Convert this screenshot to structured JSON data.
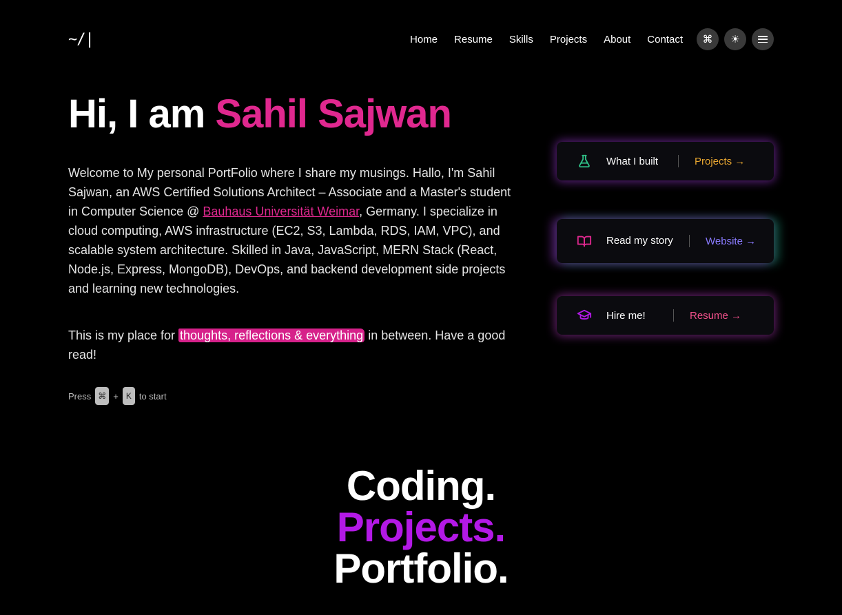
{
  "header": {
    "logo": "~/|",
    "nav": [
      "Home",
      "Resume",
      "Skills",
      "Projects",
      "About",
      "Contact"
    ],
    "icons": [
      "command-icon",
      "sun-icon",
      "menu-icon"
    ],
    "command_glyph": "⌘",
    "sun_glyph": "☀"
  },
  "hero": {
    "greeting": "Hi, I am ",
    "name": "Sahil Sajwan"
  },
  "intro": {
    "text_before_link": "Welcome to My personal PortFolio where I share my musings. Hallo, I'm Sahil Sajwan, an AWS Certified Solutions Architect – Associate and a Master's student in Computer Science @ ",
    "link_text": "Bauhaus Universität Weimar",
    "text_after_link": ", Germany. I specialize in cloud computing, AWS infrastructure (EC2, S3, Lambda, RDS, IAM, VPC), and scalable system architecture. Skilled in Java, JavaScript, MERN Stack (React, Node.js, Express, MongoDB), DevOps, and backend development side projects and learning new technologies."
  },
  "intro2": {
    "before": "This is my place for ",
    "highlight": "thoughts, reflections & everything",
    "after": " in between. Have a good read!"
  },
  "press_hint": {
    "press": "Press",
    "key1": "⌘",
    "plus": "+",
    "key2": "K",
    "to_start": "to start"
  },
  "cards": [
    {
      "icon": "flask-icon",
      "label": "What I built",
      "link": "Projects →",
      "color": "#e6a530"
    },
    {
      "icon": "book-icon",
      "label": "Read my story",
      "link": "Website →",
      "color": "#8a7bff"
    },
    {
      "icon": "graduation-cap-icon",
      "label": "Hire me!",
      "link": "Resume →",
      "color": "#f0508a"
    }
  ],
  "tagline": {
    "line1": "Coding.",
    "line2": "Projects.",
    "line3": "Portfolio."
  },
  "colors": {
    "accent_pink": "#e0288f",
    "accent_purple": "#b319e6",
    "background": "#000000"
  }
}
